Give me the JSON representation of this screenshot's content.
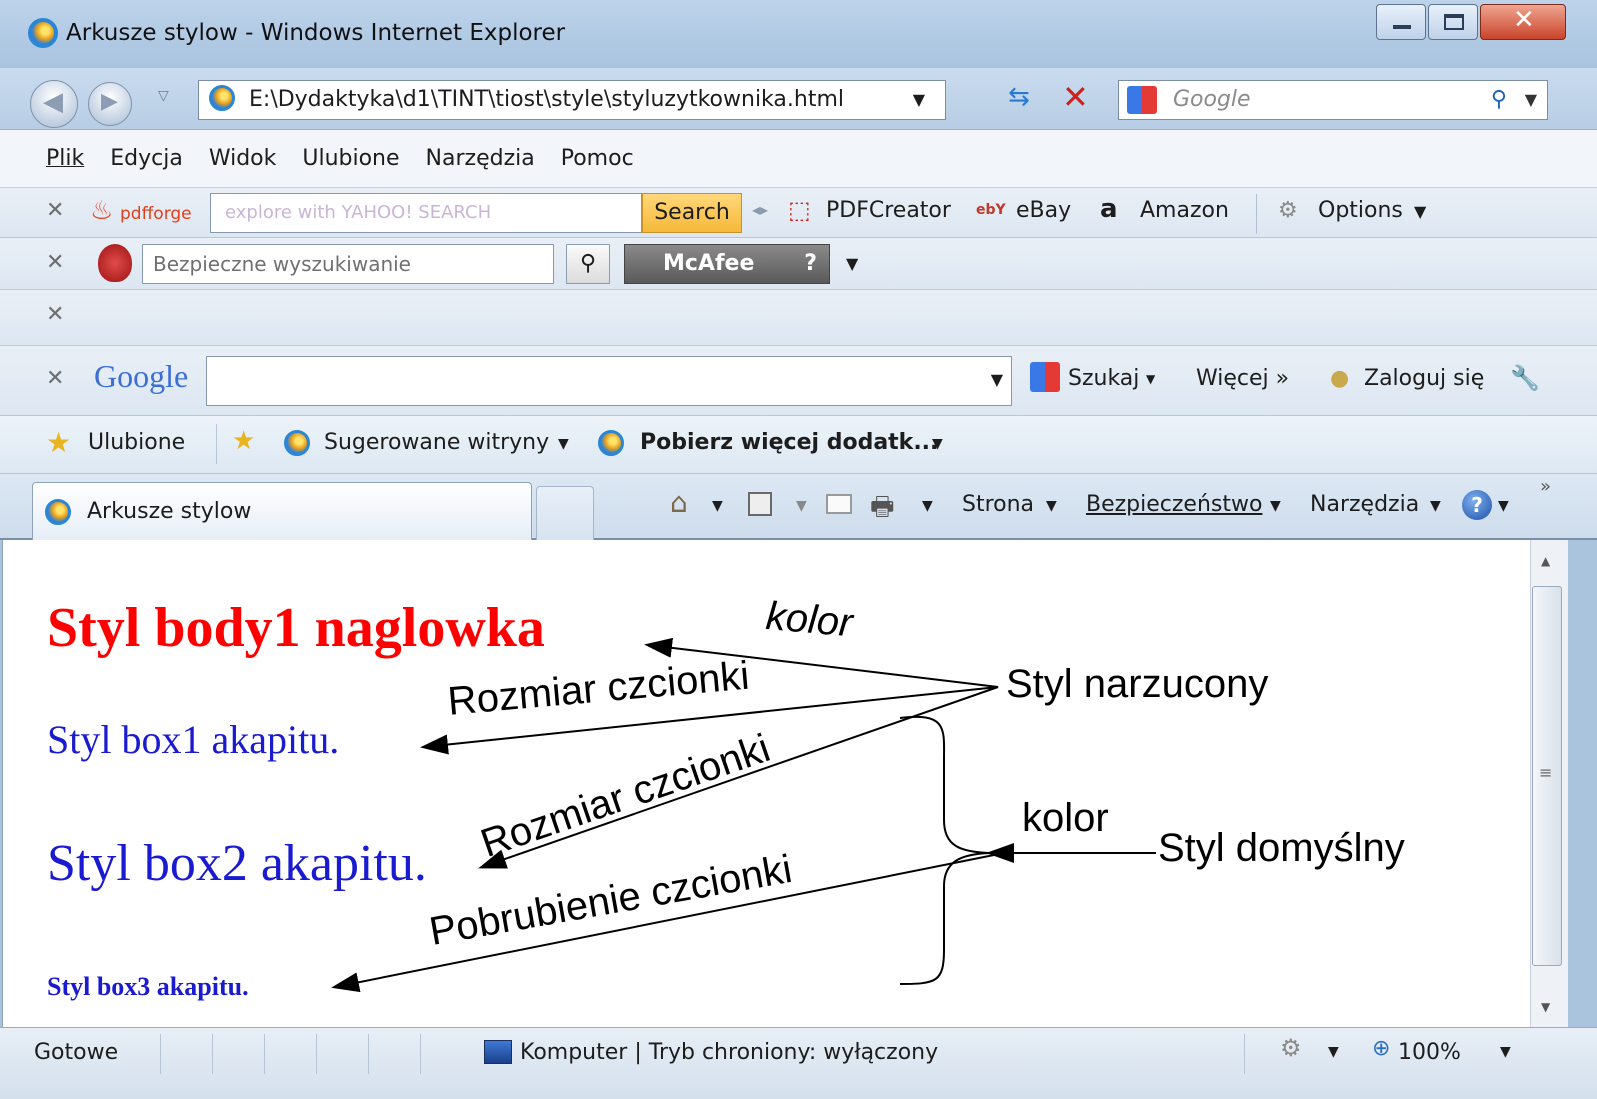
{
  "window": {
    "title": "Arkusze stylow - Windows Internet Explorer"
  },
  "address_bar": {
    "url": "E:\\Dydaktyka\\d1\\TINT\\tiost\\style\\styluzytkownika.html",
    "search_placeholder": "Google"
  },
  "menu": [
    {
      "label": "Plik"
    },
    {
      "label": "Edycja"
    },
    {
      "label": "Widok"
    },
    {
      "label": "Ulubione"
    },
    {
      "label": "Narzędzia"
    },
    {
      "label": "Pomoc"
    }
  ],
  "pdfforge_toolbar": {
    "brand": "pdfforge",
    "search_hint": "explore with YAHOO! SEARCH",
    "search_button": "Search",
    "links": [
      "PDFCreator",
      "eBay",
      "Amazon",
      "Options"
    ]
  },
  "mcafee_toolbar": {
    "search_placeholder": "Bezpieczne wyszukiwanie",
    "brand": "McAfee"
  },
  "google_toolbar": {
    "logo": "Google",
    "search_button": "Szukaj",
    "more": "Więcej »",
    "signin": "Zaloguj się"
  },
  "favorites_bar": {
    "favorites": "Ulubione",
    "suggested": "Sugerowane witryny",
    "more_addons": "Pobierz więcej dodatk..."
  },
  "tab": {
    "title": "Arkusze stylow"
  },
  "command_bar": [
    "Strona",
    "Bezpieczeństwo",
    "Narzędzia"
  ],
  "page": {
    "heading": "Styl body1 naglowka",
    "box1": "Styl box1 akapitu.",
    "box2": "Styl box2 akapitu.",
    "box3": "Styl box3 akapitu."
  },
  "annotations": {
    "kolor_top": "kolor",
    "rozmiar1": "Rozmiar czcionki",
    "rozmiar2": "Rozmiar czcionki",
    "pogrubienie": "Pobrubienie czcionki",
    "styl_narzucony": "Styl narzucony",
    "kolor_mid": "kolor",
    "styl_domyslny": "Styl domyślny"
  },
  "status_bar": {
    "status": "Gotowe",
    "zone": "Komputer | Tryb chroniony: wyłączony",
    "zoom": "100%"
  },
  "colors": {
    "heading": "#ff0000",
    "box": "#1a1ad0"
  }
}
